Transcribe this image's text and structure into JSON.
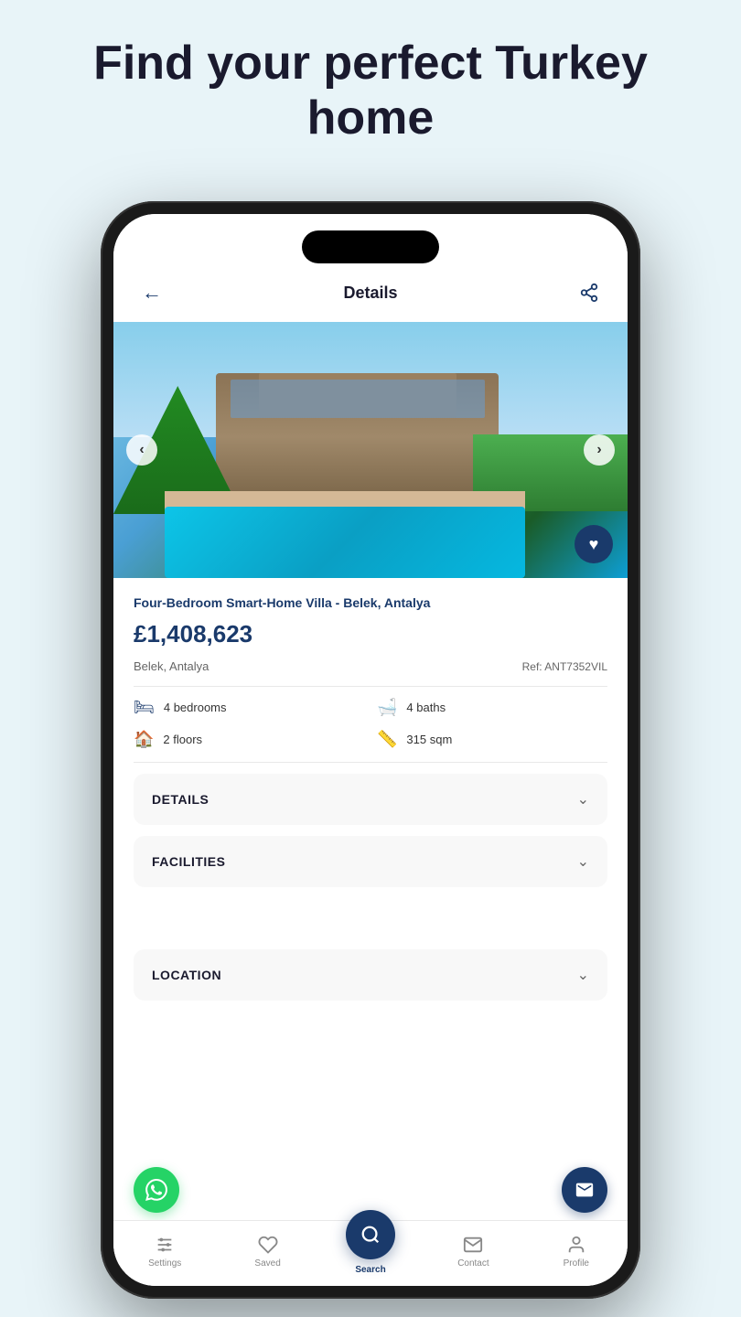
{
  "hero": {
    "title": "Find your perfect Turkey home"
  },
  "phone": {
    "screen": {
      "header": {
        "back_label": "←",
        "title": "Details",
        "share_label": "⎋"
      },
      "image_slider": {
        "prev_label": "‹",
        "next_label": "›"
      },
      "property": {
        "title": "Four-Bedroom Smart-Home Villa - Belek, Antalya",
        "price": "£1,408,623",
        "location": "Belek, Antalya",
        "ref": "Ref: ANT7352VIL",
        "bedrooms": "4 bedrooms",
        "baths": "4 baths",
        "floors": "2 floors",
        "sqm": "315 sqm"
      },
      "accordion": {
        "details_label": "DETAILS",
        "facilities_label": "FACILITIES",
        "location_label": "LOCATION"
      },
      "bottom_nav": {
        "settings_label": "Settings",
        "saved_label": "Saved",
        "search_label": "Search",
        "contact_label": "Contact",
        "profile_label": "Profile"
      },
      "colors": {
        "brand_blue": "#1a3a6b",
        "accent_green": "#25D366",
        "light_bg": "#f8f8f8"
      }
    }
  }
}
